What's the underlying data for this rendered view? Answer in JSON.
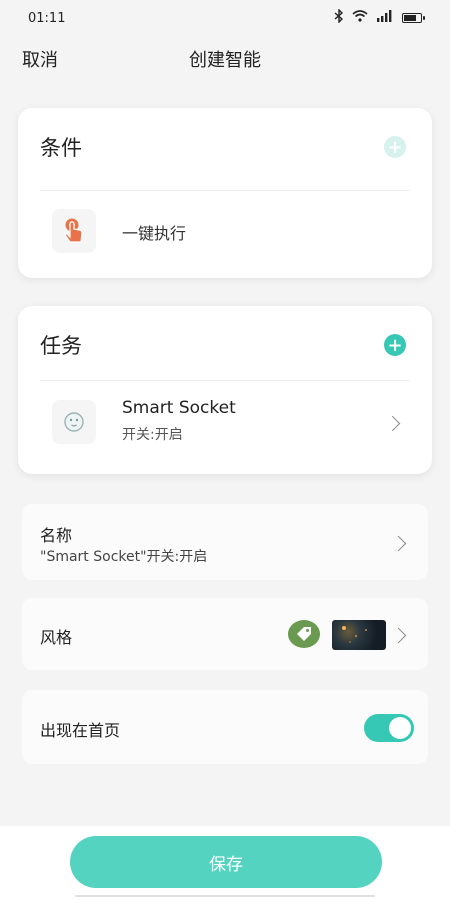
{
  "status_bar": {
    "time": "01:11",
    "icons": [
      "bluetooth-icon",
      "wifi-icon",
      "signal-icon",
      "battery-icon"
    ]
  },
  "header": {
    "cancel_label": "取消",
    "title": "创建智能"
  },
  "conditions": {
    "title": "条件",
    "items": [
      {
        "label": "一键执行",
        "icon": "tap-hand-icon"
      }
    ]
  },
  "tasks": {
    "title": "任务",
    "items": [
      {
        "name": "Smart Socket",
        "status": "开关:开启",
        "icon": "socket-icon"
      }
    ]
  },
  "settings": {
    "name": {
      "label": "名称",
      "value": "\"Smart Socket\"开关:开启"
    },
    "style": {
      "label": "风格",
      "tag_icon": "tag-icon",
      "thumbnail": "style-thumbnail"
    },
    "show_on_home": {
      "label": "出现在首页",
      "enabled": true
    }
  },
  "save_label": "保存",
  "colors": {
    "accent": "#37c8b5",
    "save_button": "#55d3c1",
    "tag": "#6a9a4f",
    "condition_icon": "#e8734a"
  }
}
